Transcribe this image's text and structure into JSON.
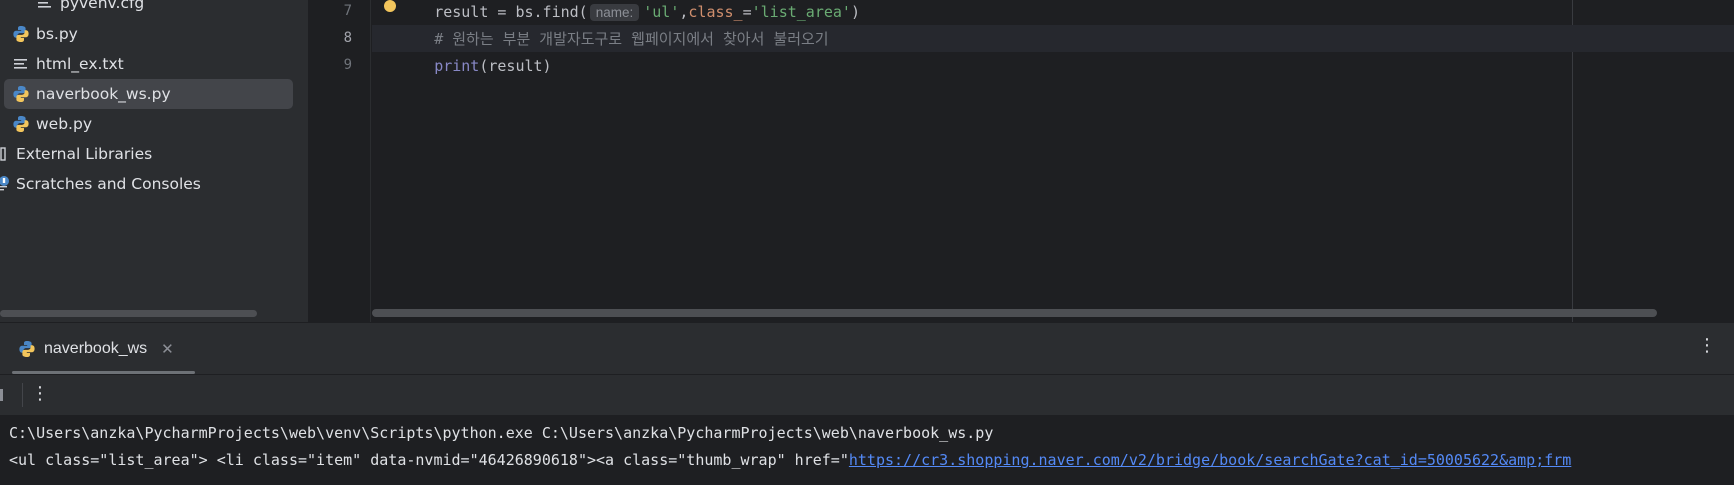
{
  "project_tree": {
    "items": [
      {
        "label": "pyvenv.cfg",
        "icon": "text-file-icon"
      },
      {
        "label": "bs.py",
        "icon": "python-file-icon"
      },
      {
        "label": "html_ex.txt",
        "icon": "text-file-icon"
      },
      {
        "label": "naverbook_ws.py",
        "icon": "python-file-icon",
        "selected": true
      },
      {
        "label": "web.py",
        "icon": "python-file-icon"
      },
      {
        "label": "External Libraries",
        "icon": "library-icon"
      },
      {
        "label": "Scratches and Consoles",
        "icon": "scratches-icon"
      }
    ]
  },
  "editor": {
    "line_numbers": [
      "7",
      "8",
      "9"
    ],
    "current_line": "8",
    "line7": {
      "t1": "result = bs.find(",
      "hint": "name:",
      "t2": "'ul'",
      "t3": ",",
      "t4": "class_",
      "t5": "=",
      "t6": "'list_area'",
      "t7": ")"
    },
    "line8": {
      "comment": "# 원하는 부분 개발자도구로 웹페이지에서 찾아서 불러오기"
    },
    "line9": {
      "fn": "print",
      "rest": "(result)"
    }
  },
  "run_window": {
    "tab_label": "naverbook_ws",
    "close_glyph": "✕",
    "more_glyph": "⋮",
    "console": {
      "line1": "C:\\Users\\anzka\\PycharmProjects\\web\\venv\\Scripts\\python.exe C:\\Users\\anzka\\PycharmProjects\\web\\naverbook_ws.py",
      "line2_prefix": "<ul class=\"list_area\"> <li class=\"item\" data-nvmid=\"46426890618\"><a class=\"thumb_wrap\" href=\"",
      "line2_link": "https://cr3.shopping.naver.com/v2/bridge/book/searchGate?cat_id=50005622&amp;frm"
    }
  },
  "colors": {
    "string": "#6aab73",
    "keyword": "#cf8e6d",
    "builtin": "#8888c6",
    "comment": "#7a7e85",
    "link": "#548af7"
  }
}
